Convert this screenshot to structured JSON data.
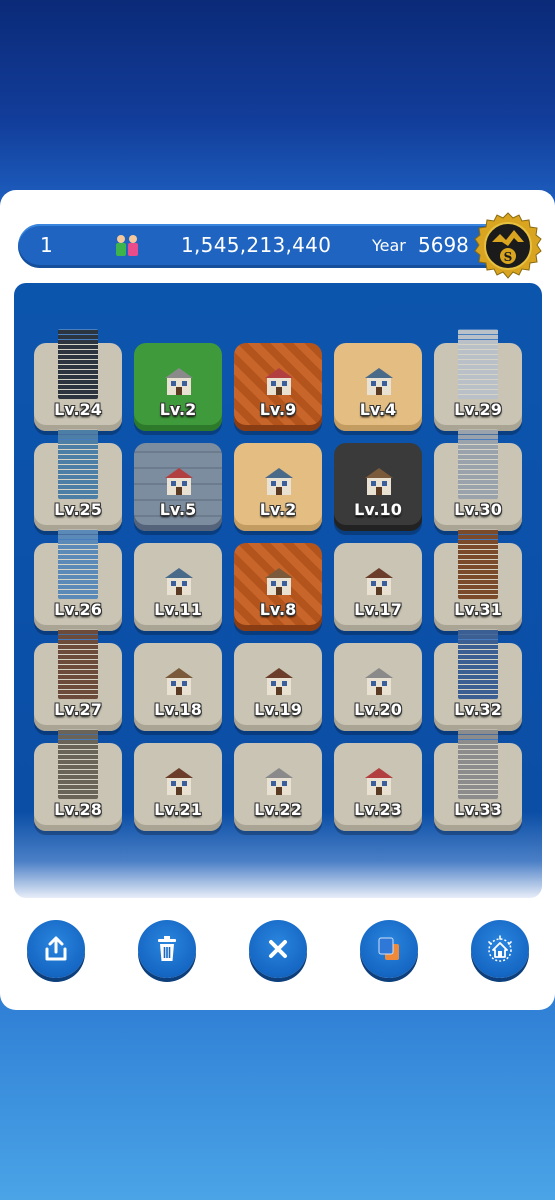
{
  "header": {
    "level": "1",
    "money": "1,545,213,440",
    "year_label": "Year",
    "year": "5698"
  },
  "grid": {
    "rows": [
      [
        {
          "label": "Lv.24",
          "tile": "empty"
        },
        {
          "label": "Lv.2",
          "tile": "grass"
        },
        {
          "label": "Lv.9",
          "tile": "brick"
        },
        {
          "label": "Lv.4",
          "tile": "sand"
        },
        {
          "label": "Lv.29",
          "tile": "empty"
        }
      ],
      [
        {
          "label": "Lv.25",
          "tile": "empty"
        },
        {
          "label": "Lv.5",
          "tile": "stone"
        },
        {
          "label": "Lv.2",
          "tile": "sand"
        },
        {
          "label": "Lv.10",
          "tile": "asphalt"
        },
        {
          "label": "Lv.30",
          "tile": "empty"
        }
      ],
      [
        {
          "label": "Lv.26",
          "tile": "empty"
        },
        {
          "label": "Lv.11",
          "tile": "empty"
        },
        {
          "label": "Lv.8",
          "tile": "brick"
        },
        {
          "label": "Lv.17",
          "tile": "empty"
        },
        {
          "label": "Lv.31",
          "tile": "empty"
        }
      ],
      [
        {
          "label": "Lv.27",
          "tile": "empty"
        },
        {
          "label": "Lv.18",
          "tile": "empty"
        },
        {
          "label": "Lv.19",
          "tile": "empty"
        },
        {
          "label": "Lv.20",
          "tile": "empty"
        },
        {
          "label": "Lv.32",
          "tile": "empty"
        }
      ],
      [
        {
          "label": "Lv.28",
          "tile": "empty"
        },
        {
          "label": "Lv.21",
          "tile": "empty"
        },
        {
          "label": "Lv.22",
          "tile": "empty"
        },
        {
          "label": "Lv.23",
          "tile": "empty"
        },
        {
          "label": "Lv.33",
          "tile": "empty"
        }
      ]
    ]
  },
  "toolbar": {
    "buttons": [
      {
        "icon": "share-icon"
      },
      {
        "icon": "trash-icon"
      },
      {
        "icon": "close-icon"
      },
      {
        "icon": "copy-icon"
      },
      {
        "icon": "house-upgrade-icon"
      }
    ]
  },
  "colors": {
    "panel_bar": "#1e64c0",
    "board": "#0c55ad",
    "button": "#1567c4",
    "coin": "#d9a520"
  }
}
